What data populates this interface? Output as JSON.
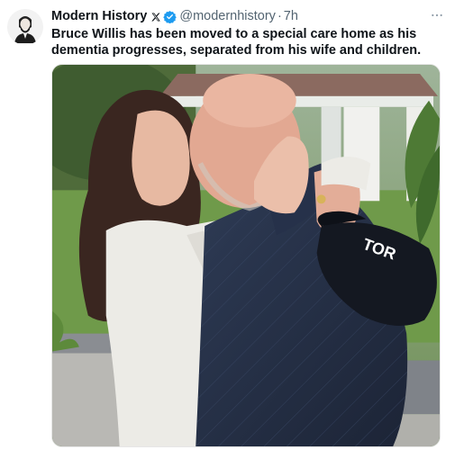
{
  "post": {
    "author": {
      "display_name": "Modern History",
      "handle": "@modernhistory",
      "avatar_icon": "lincoln-portrait-avatar",
      "platform_badge_icon": "x-logo-icon",
      "verified_icon": "verified-badge-icon"
    },
    "separator": "·",
    "timestamp": "7h",
    "more_icon": "more-options-icon",
    "text": "Bruce Willis has been moved to a special care home as his dementia progresses, separated from his wife and children.",
    "media": {
      "cap_text": "TOR"
    }
  },
  "colors": {
    "text_primary": "#0f1419",
    "text_secondary": "#536471",
    "verified_blue": "#1d9bf0"
  }
}
